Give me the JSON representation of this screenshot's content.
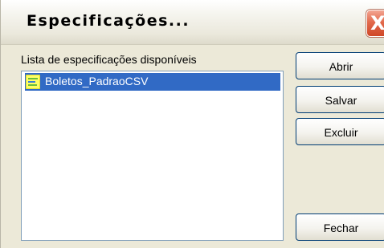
{
  "window": {
    "title": "Especificações...",
    "close_label": "X"
  },
  "list": {
    "label": "Lista de especificações disponíveis",
    "items": [
      {
        "label": "Boletos_PadraoCSV",
        "icon": "spec-file-icon",
        "selected": true
      }
    ]
  },
  "buttons": {
    "open": "Abrir",
    "save": "Salvar",
    "delete": "Excluir",
    "close": "Fechar"
  },
  "colors": {
    "selection": "#316ac5",
    "close_button": "#e26a4d",
    "window_background": "#ece9d8"
  }
}
